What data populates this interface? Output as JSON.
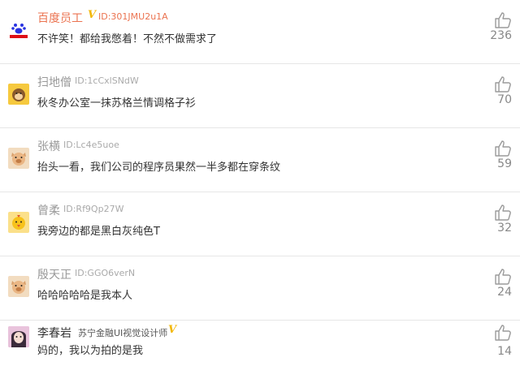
{
  "comments": [
    {
      "username": "百度员工",
      "verified": true,
      "id": "ID:301JMU2u1A",
      "text": "不许笑！都给我憋着！不然不做需求了",
      "likes": "236",
      "avatar": "baidu-logo-avatar"
    },
    {
      "username": "扫地僧",
      "verified": false,
      "id": "ID:1cCxlSNdW",
      "text": "秋冬办公室一抹苏格兰情调格子衫",
      "likes": "70",
      "avatar": "monkey-avatar"
    },
    {
      "username": "张横",
      "verified": false,
      "id": "ID:Lc4e5uoe",
      "text": "抬头一看，我们公司的程序员果然一半多都在穿条纹",
      "likes": "59",
      "avatar": "pig-avatar"
    },
    {
      "username": "曾柔",
      "verified": false,
      "id": "ID:Rf9Qp27W",
      "text": "我旁边的都是黑白灰纯色T",
      "likes": "32",
      "avatar": "chick-avatar"
    },
    {
      "username": "殷天正",
      "verified": false,
      "id": "ID:GGO6verN",
      "text": "哈哈哈哈哈是我本人",
      "likes": "24",
      "avatar": "pig-avatar"
    },
    {
      "username": "李春岩",
      "verified": true,
      "id": "苏宁金融UI视觉设计师",
      "text": "妈的，我以为拍的是我",
      "likes": "14",
      "avatar": "person-photo-avatar"
    }
  ],
  "colors": {
    "accent": "#eb7350",
    "verified": "#f2b600",
    "muted": "#999999",
    "divider": "#e6e6e6"
  }
}
